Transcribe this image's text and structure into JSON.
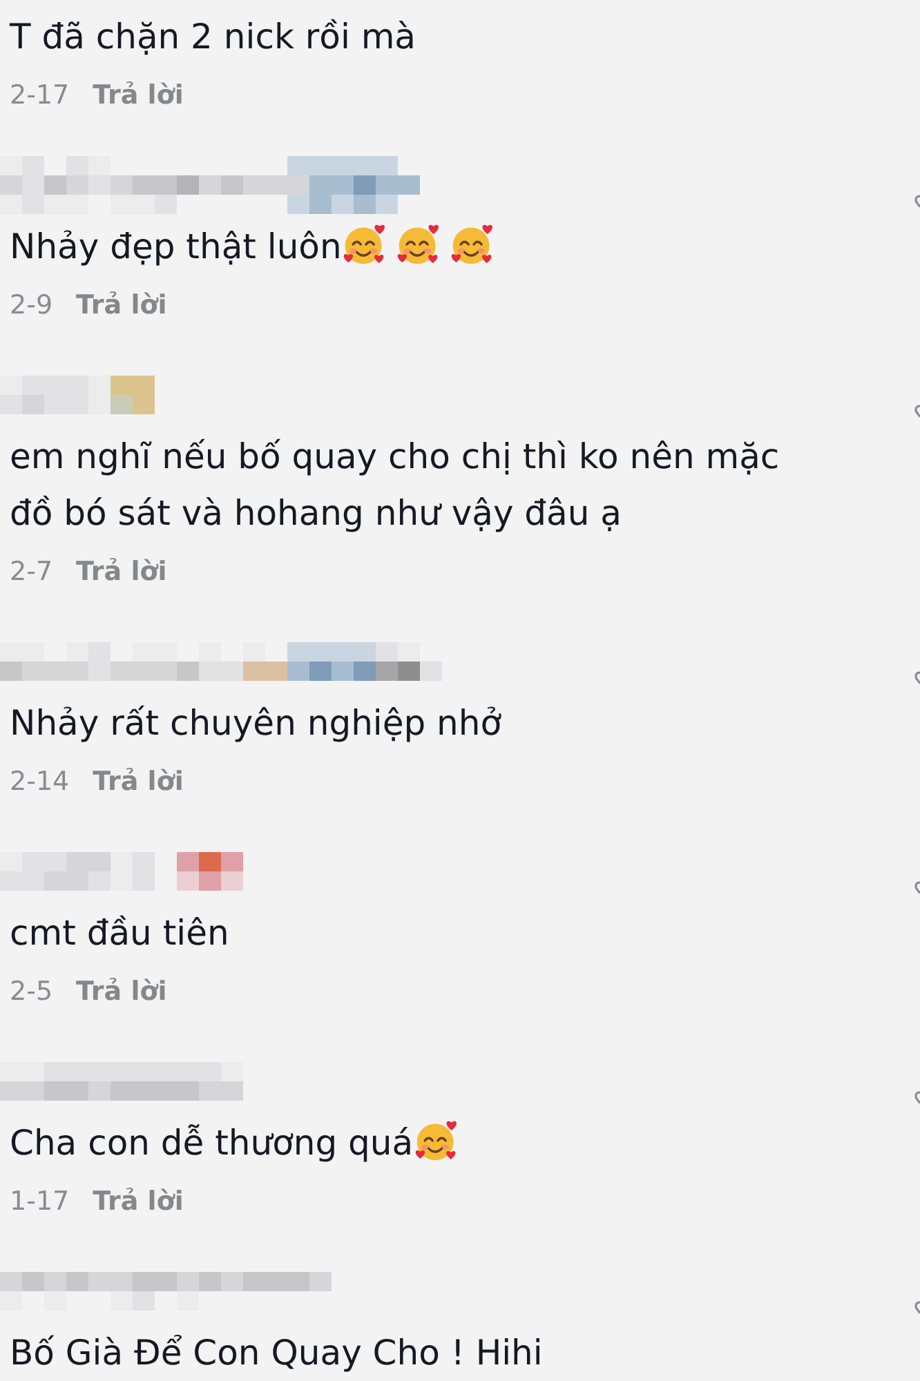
{
  "comments": [
    {
      "header_shown": false,
      "text": "T đã chặn 2 nick rồi mà",
      "date": "2-17",
      "reply": "Trả lời"
    },
    {
      "header_shown": true,
      "text": "Nhảy đẹp thật luôn",
      "emojis": [
        {
          "kind": "smiling-face-with-hearts"
        },
        {
          "kind": "smiling-face-with-hearts"
        },
        {
          "kind": "smiling-face-with-hearts"
        }
      ],
      "date": "2-9",
      "reply": "Trả lời"
    },
    {
      "header_shown": true,
      "text": "em nghĩ nếu bố quay cho chị thì ko nên mặc đồ bó sát và hohang như vậy đâu ạ",
      "date": "2-7",
      "reply": "Trả lời"
    },
    {
      "header_shown": true,
      "text": "Nhảy rất chuyên nghiệp nhở",
      "date": "2-14",
      "reply": "Trả lời"
    },
    {
      "header_shown": true,
      "text": "cmt đầu tiên",
      "date": "2-5",
      "reply": "Trả lời"
    },
    {
      "header_shown": true,
      "text": "Cha con dễ thương quá",
      "emojis": [
        {
          "kind": "smiling-face-with-hearts"
        }
      ],
      "date": "1-17",
      "reply": "Trả lời"
    },
    {
      "header_shown": true,
      "text": "Bố Già Để Con Quay Cho ! Hihi"
    }
  ]
}
